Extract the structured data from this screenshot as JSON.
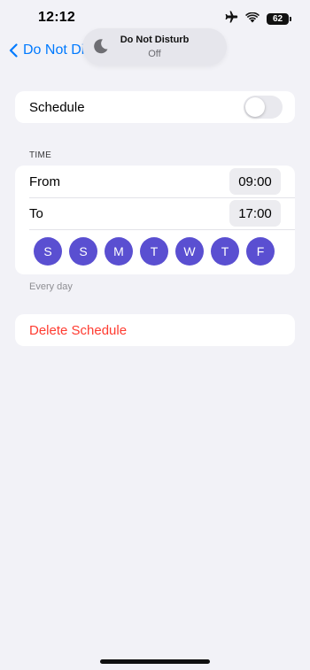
{
  "status_bar": {
    "time": "12:12",
    "battery": "62",
    "icons": [
      "airplane-icon",
      "wifi-icon",
      "battery-icon"
    ]
  },
  "nav": {
    "back_label": "Do Not Dis"
  },
  "focus_pill": {
    "title": "Do Not Disturb",
    "subtitle": "Off",
    "icon": "moon-icon"
  },
  "schedule": {
    "label": "Schedule",
    "enabled": false
  },
  "time_section": {
    "header": "TIME",
    "from_label": "From",
    "from_value": "09:00",
    "to_label": "To",
    "to_value": "17:00",
    "days": [
      "S",
      "S",
      "M",
      "T",
      "W",
      "T",
      "F"
    ],
    "footer": "Every day"
  },
  "delete": {
    "label": "Delete Schedule"
  },
  "colors": {
    "accent": "#007aff",
    "day_selected": "#5a4fd1",
    "destructive": "#ff3b30",
    "background": "#f2f2f7"
  }
}
